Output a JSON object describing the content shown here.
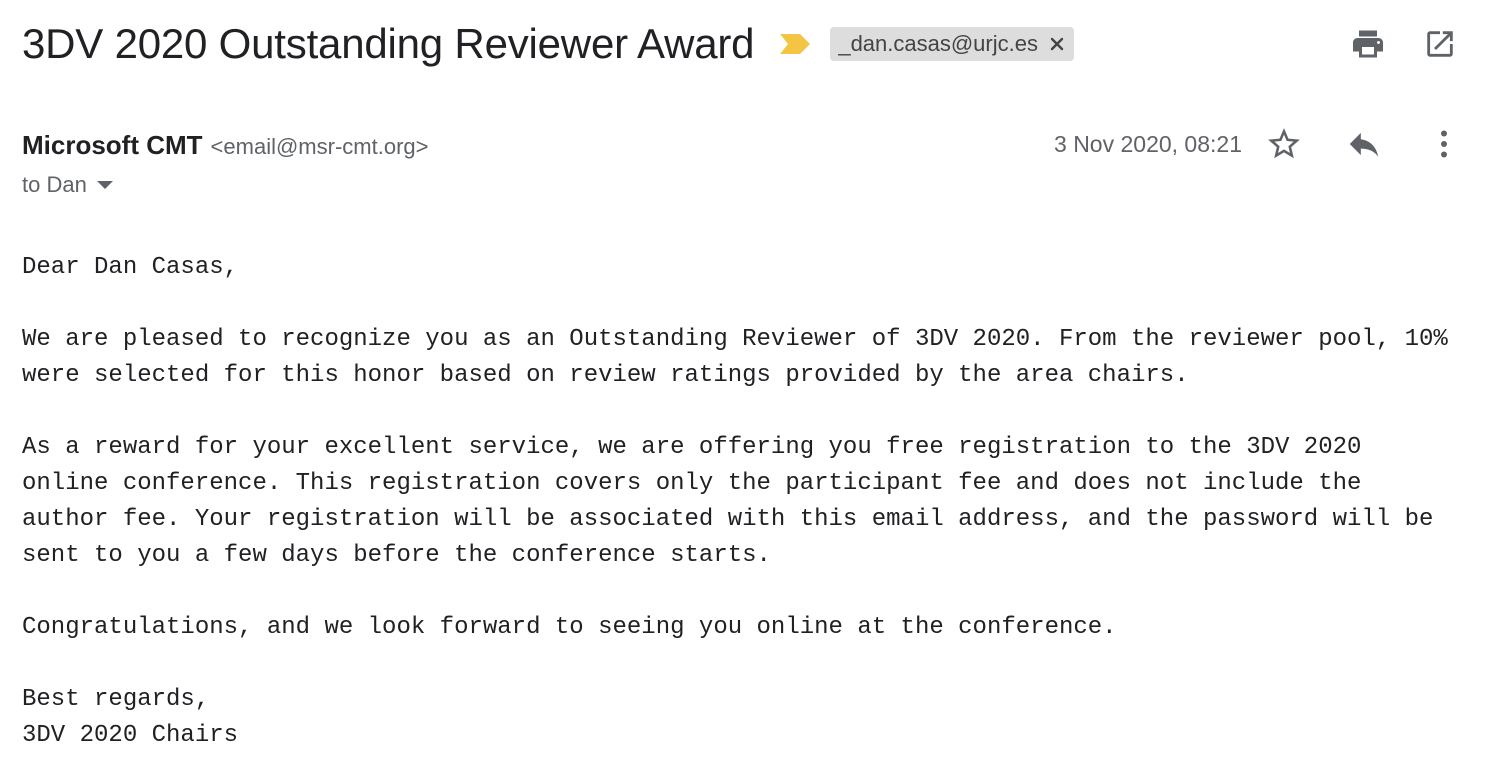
{
  "header": {
    "subject": "3DV 2020 Outstanding Reviewer Award",
    "label": "_dan.casas@urjc.es",
    "icons": {
      "importance": "importance-marker-icon",
      "remove_label": "close-icon",
      "print": "print-icon",
      "open_new_window": "open-in-new-window-icon"
    },
    "colors": {
      "importance": "#f4c542",
      "label_bg": "#dddddd"
    }
  },
  "message": {
    "sender_name": "Microsoft CMT",
    "sender_email": "<email@msr-cmt.org>",
    "recipient": "to Dan",
    "date": "3 Nov 2020, 08:21",
    "icons": {
      "star": "star-icon",
      "reply": "reply-icon",
      "more": "more-vertical-icon",
      "recipient_details": "caret-down-icon"
    }
  },
  "body": {
    "greeting": "Dear Dan Casas,",
    "para1": [
      "We are pleased to recognize you as an Outstanding Reviewer of 3DV 2020. From the reviewer pool, 10%",
      "were selected for this honor based on review ratings provided by the area chairs."
    ],
    "para2": [
      "As a reward for your excellent service, we are offering you free registration to the 3DV 2020",
      "online conference. This registration covers only the participant fee and does not include the",
      "author fee. Your registration will be associated with this email address, and the password will be",
      "sent to you a few days before the conference starts."
    ],
    "para3": "Congratulations, and we look forward to seeing you online at the conference.",
    "closing": "Best regards,",
    "signature": "3DV 2020 Chairs"
  }
}
